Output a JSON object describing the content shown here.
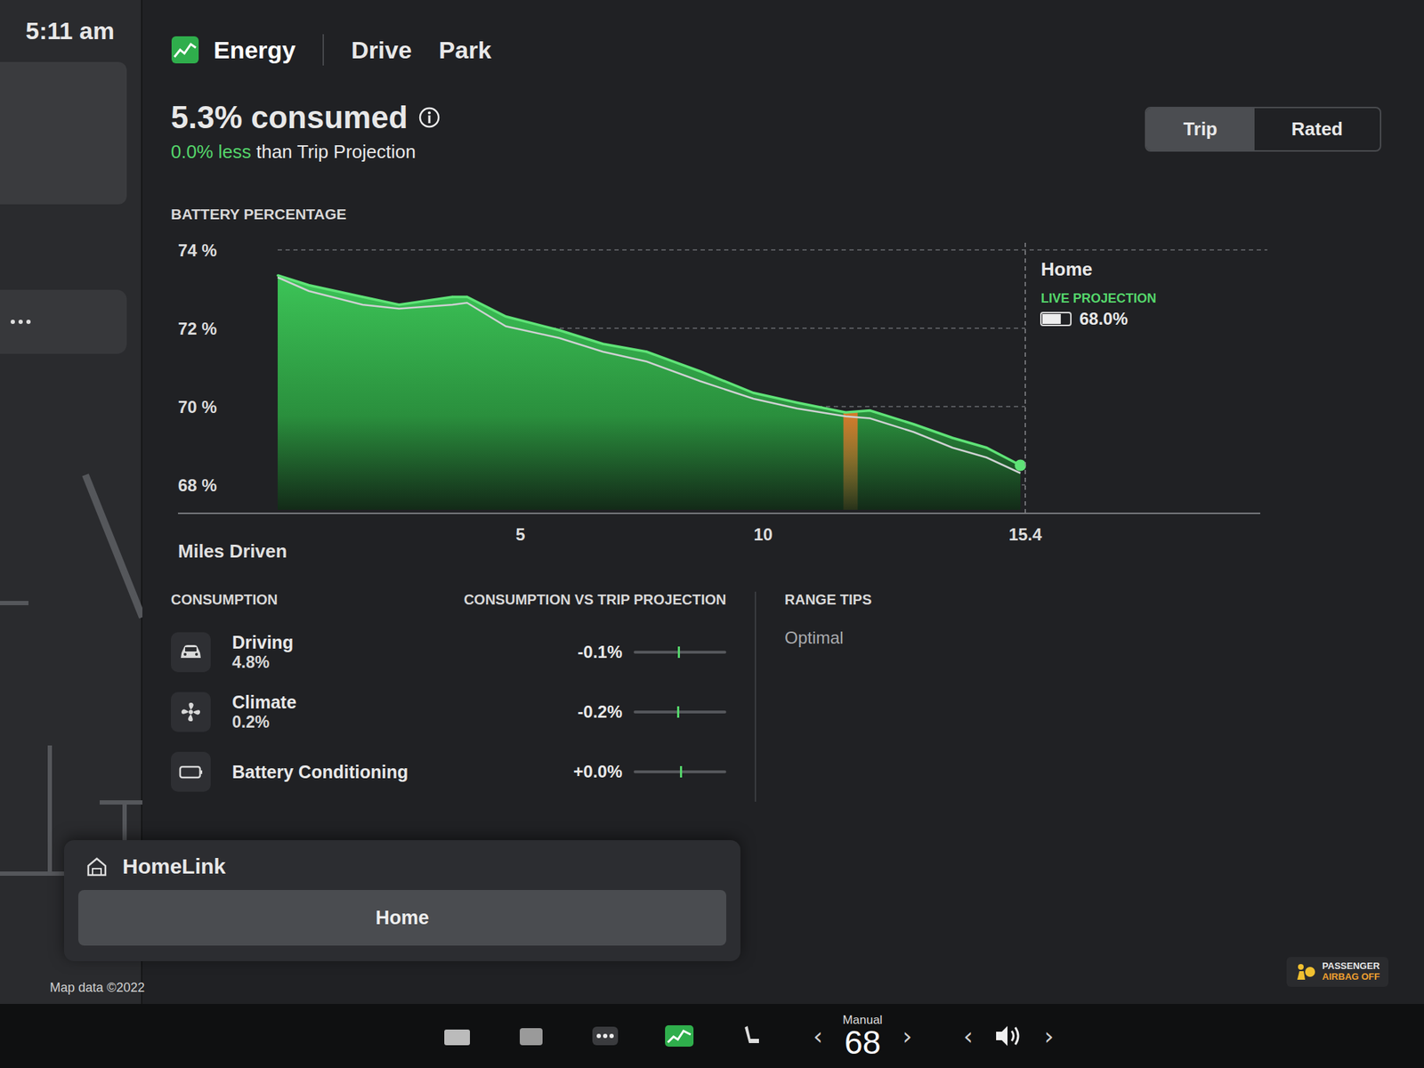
{
  "status": {
    "time": "5:11 am"
  },
  "map": {
    "attribution": "Map data ©2022"
  },
  "tabs": [
    {
      "label": "Energy",
      "selected": true
    },
    {
      "label": "Drive",
      "selected": false
    },
    {
      "label": "Park",
      "selected": false
    }
  ],
  "summary": {
    "consumed": "5.3% consumed",
    "delta": "0.0% less",
    "delta_suffix": "than Trip Projection"
  },
  "mode_toggle": [
    {
      "label": "Trip",
      "selected": true
    },
    {
      "label": "Rated",
      "selected": false
    }
  ],
  "chart": {
    "y_title": "BATTERY PERCENTAGE",
    "y_ticks": [
      "74 %",
      "72 %",
      "70 %",
      "68 %"
    ],
    "x_title": "Miles Driven",
    "x_ticks": [
      "5",
      "10",
      "15.4"
    ],
    "miles": [
      0,
      0.64,
      1.75,
      2.5,
      3.6,
      3.9,
      4.7,
      5.8,
      6.7,
      7.6,
      8.7,
      9.8,
      10.7,
      11.7,
      12.2,
      13.1,
      13.9,
      14.6,
      15.3
    ],
    "actual": [
      73.35,
      73.1,
      72.8,
      72.6,
      72.8,
      72.8,
      72.3,
      71.95,
      71.6,
      71.4,
      70.9,
      70.35,
      70.1,
      69.85,
      69.9,
      69.55,
      69.2,
      68.95,
      68.5
    ],
    "projection": [
      73.3,
      72.95,
      72.6,
      72.5,
      72.6,
      72.65,
      72.05,
      71.75,
      71.4,
      71.15,
      70.65,
      70.2,
      69.95,
      69.75,
      69.7,
      69.35,
      68.95,
      68.7,
      68.3
    ],
    "highlight_mile": 11.8,
    "highlight_color": "#e0782a",
    "destination": "Home",
    "projection_label": "LIVE PROJECTION",
    "projection_value": "68.0%"
  },
  "consumption": {
    "title": "CONSUMPTION",
    "vs_title": "CONSUMPTION VS TRIP PROJECTION",
    "items": [
      {
        "kind": "driving",
        "name": "Driving",
        "value": "4.8%",
        "delta": "-0.1%",
        "level": 0.48
      },
      {
        "kind": "climate",
        "name": "Climate",
        "value": "0.2%",
        "delta": "-0.2%",
        "level": 0.47
      },
      {
        "kind": "conditioning",
        "name": "Battery Conditioning",
        "delta": "+0.0%",
        "level": 0.5
      }
    ]
  },
  "range_tips": {
    "title": "RANGE TIPS",
    "text": "Optimal"
  },
  "homelink": {
    "title": "HomeLink",
    "button": "Home"
  },
  "airbag": {
    "line1": "PASSENGER",
    "line2": "AIRBAG OFF"
  },
  "climate": {
    "mode": "Manual",
    "temperature": "68",
    "decrease": "‹",
    "increase": "›"
  },
  "volume": {
    "decrease": "‹",
    "increase": "›"
  }
}
